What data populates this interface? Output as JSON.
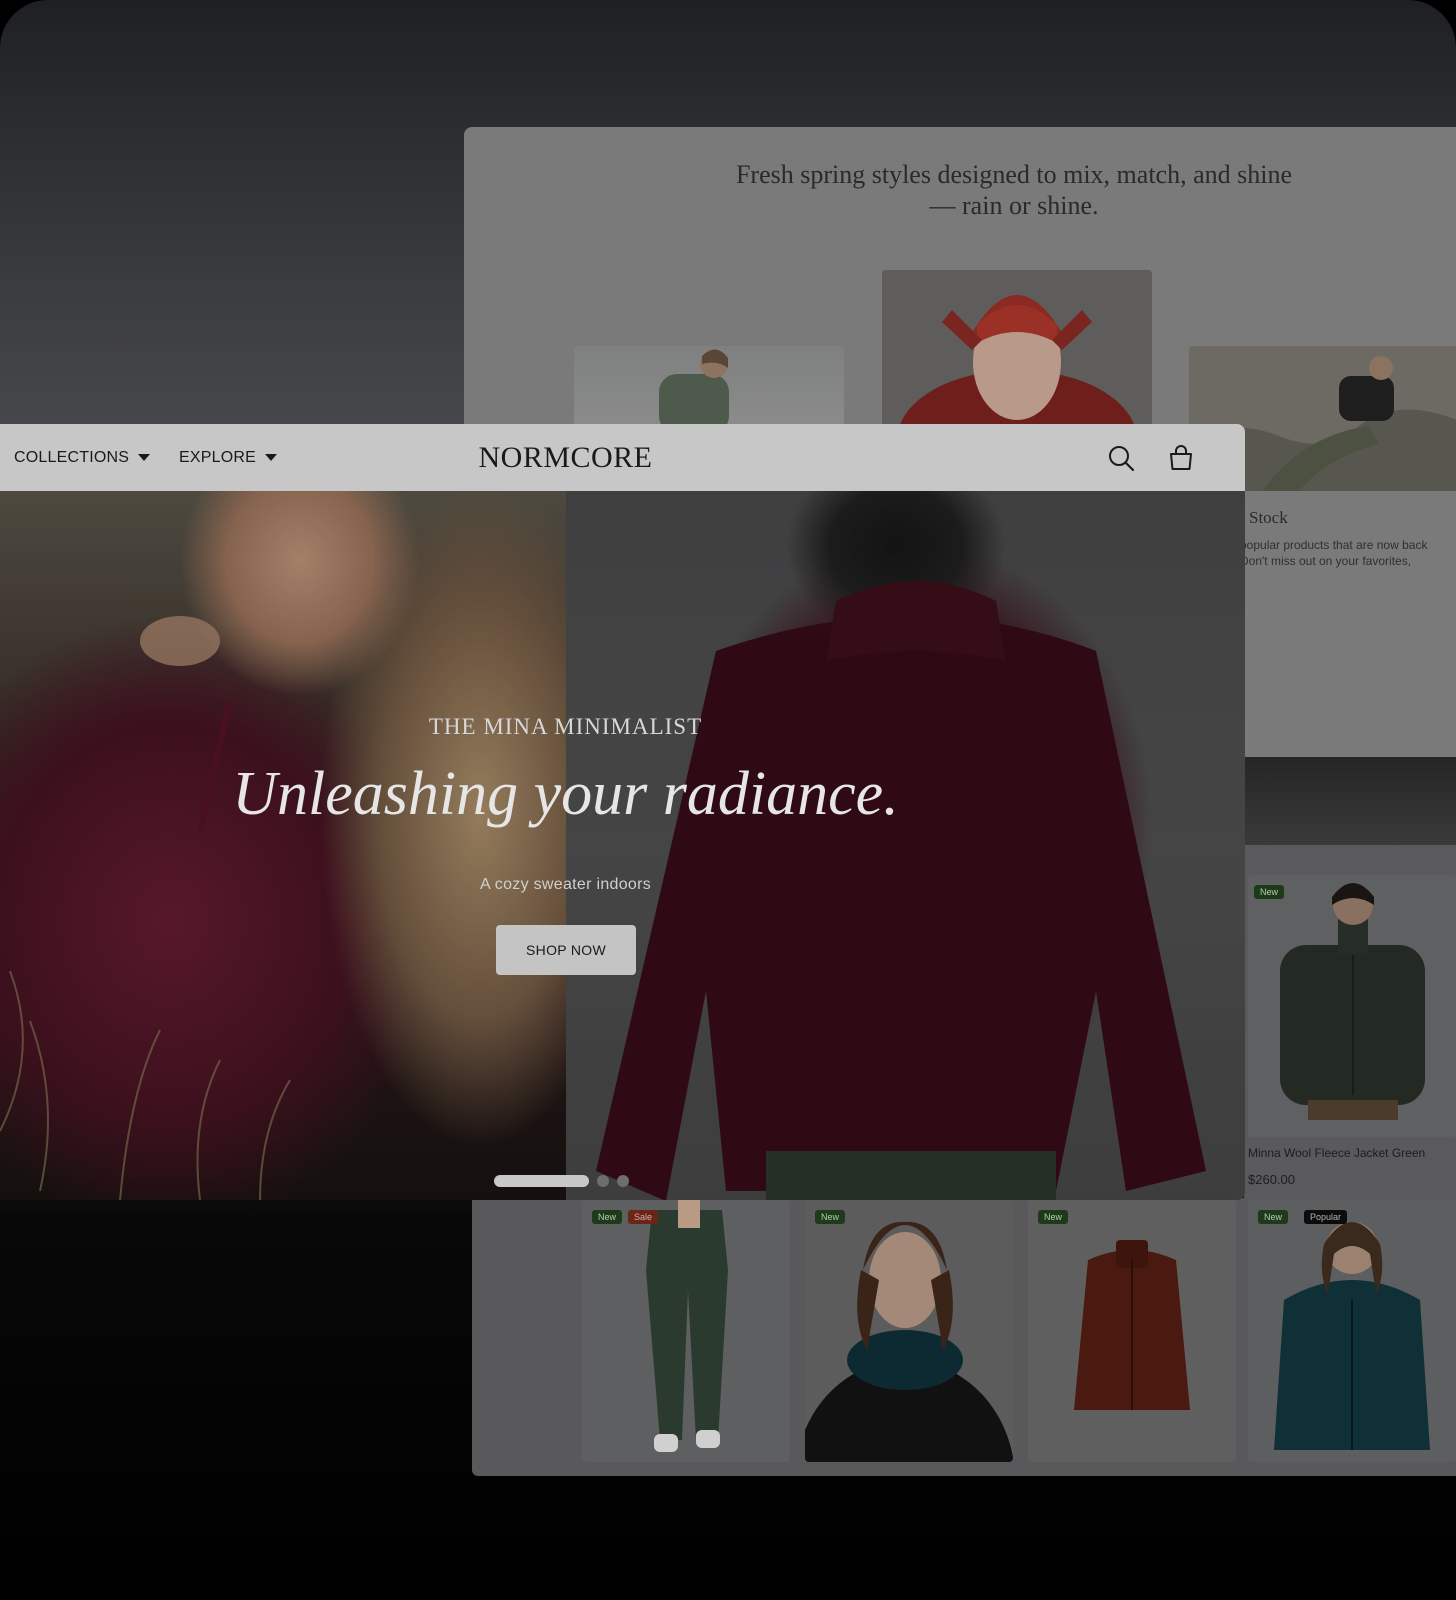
{
  "back_window": {
    "tagline_line1": "Fresh spring styles designed to mix, match, and shine",
    "tagline_line2": "— rain or shine.",
    "stock_title": "Stock",
    "stock_desc_line1": "popular products that are now back",
    "stock_desc_line2": "Don't miss out on your favorites,",
    "stock_desc_line3": "!"
  },
  "products": [
    {
      "badges": [
        "New"
      ],
      "name": "Minna Wool Fleece Jacket Green",
      "price": "$260.00"
    },
    {
      "badges": [
        "New",
        "Sale"
      ]
    },
    {
      "badges": [
        "New"
      ]
    },
    {
      "badges": [
        "New"
      ]
    },
    {
      "badges": [
        "New",
        "Popular"
      ]
    }
  ],
  "nav": {
    "collections": "COLLECTIONS",
    "explore": "EXPLORE",
    "logo": "NORMCORE"
  },
  "hero": {
    "eyebrow": "THE MINA MINIMALIST",
    "title": "Unleashing your radiance.",
    "subtitle": "A cozy sweater indoors",
    "cta": "SHOP NOW",
    "slides_total": 3,
    "slide_active": 1
  },
  "icons": {
    "search": "search-icon",
    "cart": "shopping-bag-icon",
    "caret": "caret-down-icon"
  },
  "colors": {
    "nav_bg": "#c7c7c8",
    "button_bg": "#c4c4c5",
    "badge_new": "#1d3a1a",
    "badge_sale": "#6b2418"
  }
}
